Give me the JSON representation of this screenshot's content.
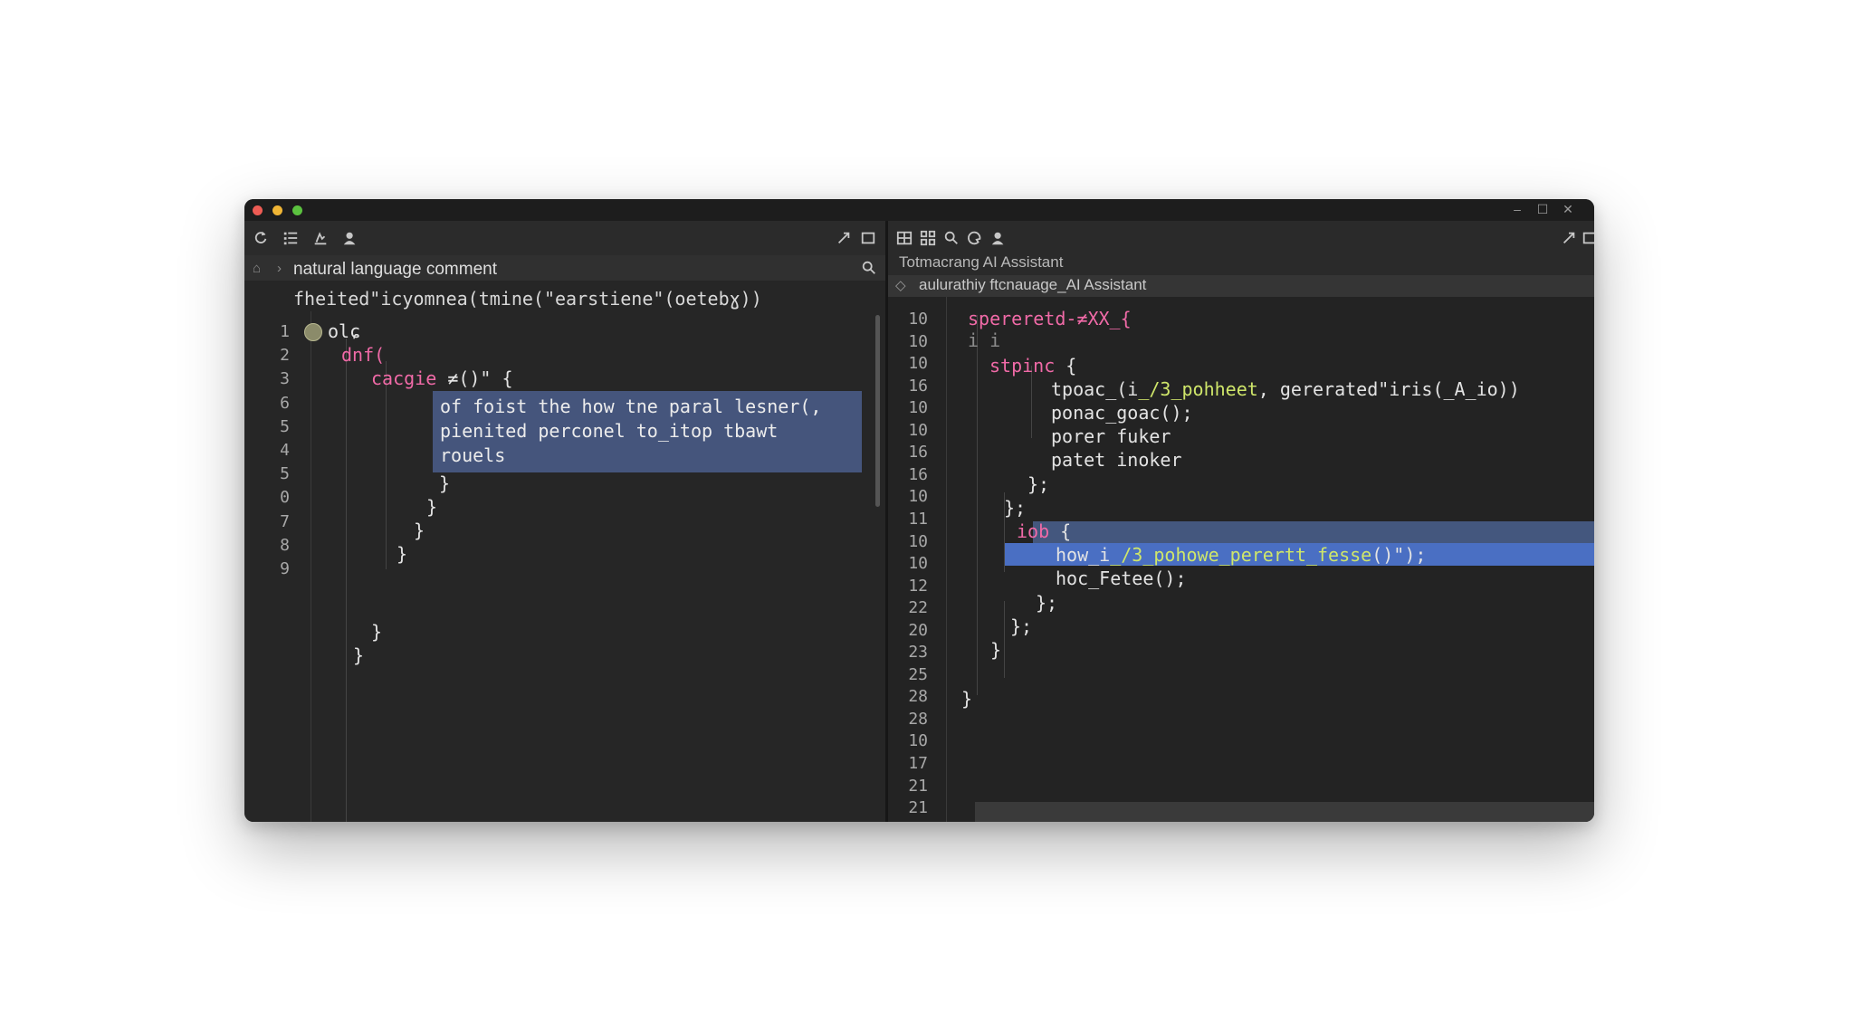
{
  "window": {
    "titlebar": {
      "minimize": "–",
      "maximize": "☐",
      "close": "✕"
    }
  },
  "left": {
    "toolbar_icons": [
      "refresh-icon",
      "list-icon",
      "chart-icon",
      "user-icon",
      "expand-icon",
      "maximize-icon"
    ],
    "search": {
      "text": "natural language comment"
    },
    "header_line": "fheited\"icyomnea(tmine(\"earstiene\"(oetebɣ))",
    "line_numbers": [
      "1",
      "2",
      "3",
      "6",
      "5",
      "4",
      "5",
      "0",
      "7",
      "8",
      "9"
    ],
    "code": {
      "l1": "olɕ",
      "l2": "dnf(",
      "l3_kw": "cacgie",
      "l3_rest": " ≠()\" {",
      "sel1": "of foist the how tne paral lesner(,",
      "sel2": "pienited perconel to_itop tbawt",
      "sel3": "rouels",
      "b1": "}",
      "b2": "}",
      "b3": "}",
      "b4": "}",
      "b5": "}",
      "b6": "}"
    }
  },
  "right": {
    "toolbar_icons": [
      "split-view-icon",
      "grid-icon",
      "zoom-icon",
      "palette-icon",
      "user-icon",
      "expand-icon",
      "maximize-icon"
    ],
    "title": "Totmacrang AI Assistant",
    "subtitle": "aulurathiy ftcnauage_AI Assistant",
    "line_numbers": [
      "10",
      "10",
      "10",
      "16",
      "10",
      "10",
      "16",
      "16",
      "10",
      "11",
      "10",
      "10",
      "12",
      "22",
      "20",
      "23",
      "25",
      "28",
      "28",
      "10",
      "17",
      "21",
      "21"
    ],
    "code": {
      "r1": "spereretd-≠XX_{",
      "r2": "i i",
      "r3_kw": "stpinc",
      "r3_rest": " {",
      "r4a": "tpoac_(i",
      "r4str": "_/3_pohheet",
      "r4b": ", gererated\"iris(_A_io))",
      "r5": "ponac_goac();",
      "r6": "porer fuker",
      "r7": "patet inoker",
      "r8": "};",
      "r9": "};",
      "r10_kw": "iob",
      "r10_rest": " {",
      "r11a": "how_i",
      "r11str": "_/3_pohowe_perertt_fesse",
      "r11b": "()\");",
      "r12": "hoc_Fetee();",
      "r13": "};",
      "r14": "};",
      "r15": "}",
      "r16": "}"
    }
  }
}
